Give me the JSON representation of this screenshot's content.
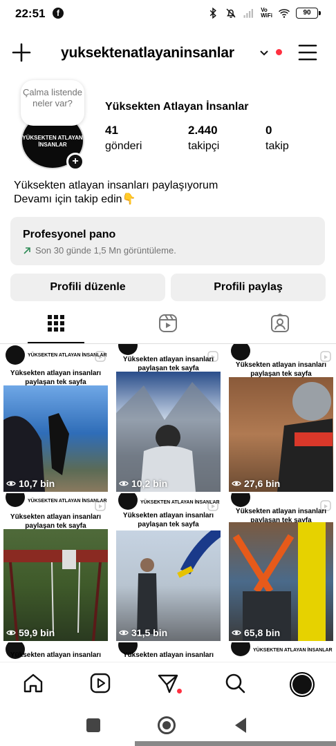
{
  "status_bar": {
    "time": "22:51",
    "volte_line1": "Vo",
    "volte_line2": "WiFi",
    "battery": "90"
  },
  "header": {
    "username": "yuksektenatlayaninsanlar"
  },
  "profile": {
    "note": "Çalma listende neler var?",
    "avatar_text": "YÜKSEKTEN ATLAYAN İNSANLAR",
    "display_name": "Yüksekten Atlayan İnsanlar",
    "stats": [
      {
        "number": "41",
        "label": "gönderi"
      },
      {
        "number": "2.440",
        "label": "takipçi"
      },
      {
        "number": "0",
        "label": "takip"
      }
    ],
    "bio_line1": "Yüksekten atlayan insanları paylaşıyorum",
    "bio_line2": "Devamı için takip edin👇"
  },
  "pro_panel": {
    "title": "Profesyonel pano",
    "subtitle": "Son 30 günde 1,5 Mn görüntüleme."
  },
  "buttons": {
    "edit": "Profili düzenle",
    "share": "Profili paylaş"
  },
  "grid": {
    "header_text": "YÜKSEKTEN ATLAYAN İNSANLAR",
    "caption": "Yüksekten atlayan insanları paylaşan tek sayfa",
    "posts": [
      {
        "views": "10,7 bin"
      },
      {
        "views": "10,2 bin"
      },
      {
        "views": "27,6 bin"
      },
      {
        "views": "59,9 bin"
      },
      {
        "views": "31,5 bin"
      },
      {
        "views": "65,8 bin"
      }
    ],
    "next_row_header": "YÜKSEKTEN ATLAYAN İNSANLAR",
    "next_row_caption": "Yüksekten atlayan insanları"
  },
  "colors": {
    "accent_red": "#ff3040",
    "panel_bg": "#efefef",
    "muted_text": "#737373",
    "trend_green": "#2e8b57"
  }
}
